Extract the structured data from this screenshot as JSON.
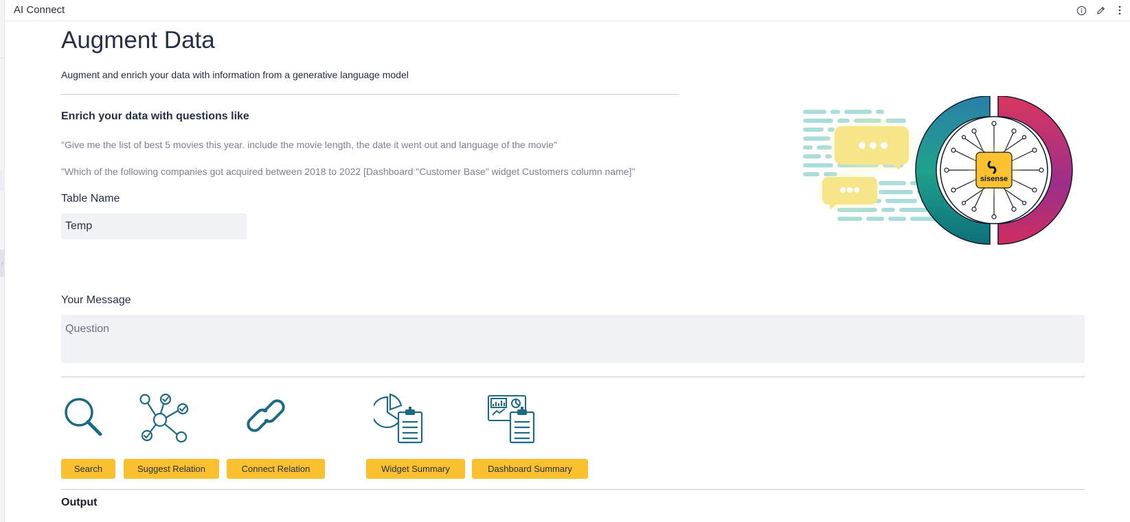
{
  "window": {
    "title": "AI Connect"
  },
  "header": {
    "title": "Augment Data",
    "subtitle": "Augment and enrich your data with information from a generative language model"
  },
  "examples": {
    "heading": "Enrich your data with questions like",
    "items": [
      "\"Give me the list of best 5 movies this year. include the movie length, the date it went out and language of the movie\"",
      "\"Which of the following companies got acquired between 2018 to 2022 [Dashboard \"Customer Base\" widget Customers column name]\""
    ]
  },
  "table_name": {
    "label": "Table Name",
    "value": "Temp"
  },
  "message": {
    "label": "Your Message",
    "placeholder": "Question",
    "value": ""
  },
  "actions": [
    {
      "label": "Search",
      "icon": "search-icon"
    },
    {
      "label": "Suggest Relation",
      "icon": "network-check-icon"
    },
    {
      "label": "Connect Relation",
      "icon": "link-icon"
    },
    {
      "label": "Widget Summary",
      "icon": "pie-clipboard-icon"
    },
    {
      "label": "Dashboard Summary",
      "icon": "dashboard-clipboard-icon"
    }
  ],
  "output": {
    "label": "Output"
  },
  "hero": {
    "brand": "sisense"
  },
  "colors": {
    "accent": "#fbc02d",
    "icon": "#1b6a84",
    "text": "#253047",
    "muted": "#7b8190",
    "input_bg": "#f1f2f6"
  }
}
